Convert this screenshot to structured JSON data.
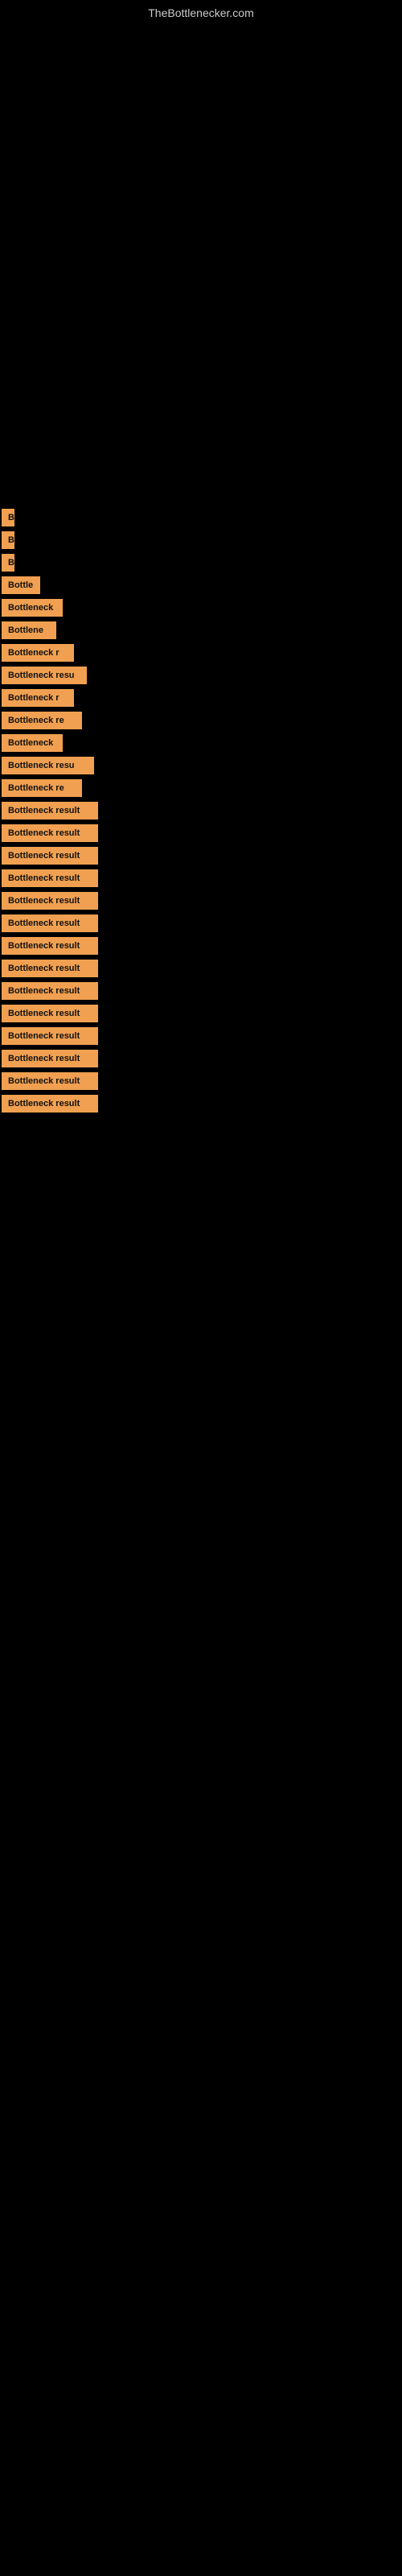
{
  "site": {
    "title": "TheBottlenecker.com"
  },
  "items": [
    {
      "label": "B",
      "width": 14
    },
    {
      "label": "B",
      "width": 14
    },
    {
      "label": "B",
      "width": 14
    },
    {
      "label": "Bottle",
      "width": 48
    },
    {
      "label": "Bottleneck",
      "width": 76
    },
    {
      "label": "Bottlene",
      "width": 68
    },
    {
      "label": "Bottleneck r",
      "width": 90
    },
    {
      "label": "Bottleneck resu",
      "width": 106
    },
    {
      "label": "Bottleneck r",
      "width": 90
    },
    {
      "label": "Bottleneck re",
      "width": 100
    },
    {
      "label": "Bottleneck",
      "width": 76
    },
    {
      "label": "Bottleneck resu",
      "width": 115
    },
    {
      "label": "Bottleneck re",
      "width": 100
    },
    {
      "label": "Bottleneck result",
      "width": 120
    },
    {
      "label": "Bottleneck result",
      "width": 120
    },
    {
      "label": "Bottleneck result",
      "width": 120
    },
    {
      "label": "Bottleneck result",
      "width": 120
    },
    {
      "label": "Bottleneck result",
      "width": 120
    },
    {
      "label": "Bottleneck result",
      "width": 120
    },
    {
      "label": "Bottleneck result",
      "width": 120
    },
    {
      "label": "Bottleneck result",
      "width": 120
    },
    {
      "label": "Bottleneck result",
      "width": 120
    },
    {
      "label": "Bottleneck result",
      "width": 120
    },
    {
      "label": "Bottleneck result",
      "width": 120
    },
    {
      "label": "Bottleneck result",
      "width": 120
    },
    {
      "label": "Bottleneck result",
      "width": 120
    },
    {
      "label": "Bottleneck result",
      "width": 120
    }
  ]
}
